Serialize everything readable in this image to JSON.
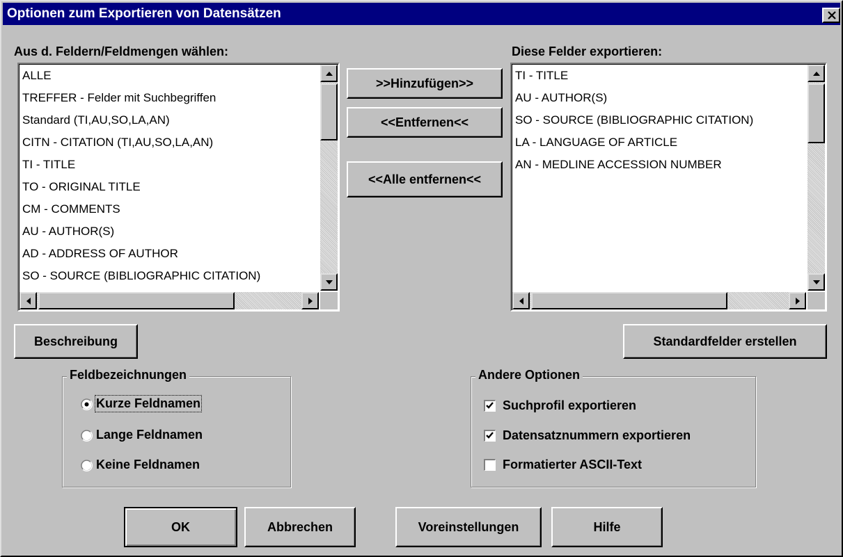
{
  "window": {
    "title": "Optionen zum Exportieren von Datensätzen"
  },
  "left_list": {
    "label": "Aus d. Feldern/Feldmengen wählen:",
    "items": [
      "ALLE",
      "TREFFER - Felder mit Suchbegriffen",
      "Standard (TI,AU,SO,LA,AN)",
      "CITN - CITATION (TI,AU,SO,LA,AN)",
      "TI - TITLE",
      "TO - ORIGINAL TITLE",
      "CM - COMMENTS",
      "AU - AUTHOR(S)",
      "AD - ADDRESS OF AUTHOR",
      "SO - SOURCE (BIBLIOGRAPHIC CITATION)"
    ]
  },
  "right_list": {
    "label": "Diese Felder exportieren:",
    "items": [
      "TI - TITLE",
      "AU - AUTHOR(S)",
      "SO - SOURCE (BIBLIOGRAPHIC CITATION)",
      "LA - LANGUAGE OF ARTICLE",
      "AN - MEDLINE ACCESSION NUMBER"
    ]
  },
  "buttons": {
    "add": ">>Hinzufügen>>",
    "remove": "<<Entfernen<<",
    "remove_all": "<<Alle entfernen<<",
    "description": "Beschreibung",
    "create_default": "Standardfelder erstellen",
    "ok": "OK",
    "cancel": "Abbrechen",
    "defaults": "Voreinstellungen",
    "help": "Hilfe"
  },
  "field_labels": {
    "title": "Feldbezeichnungen",
    "options": [
      {
        "label": "Kurze Feldnamen",
        "selected": true
      },
      {
        "label": "Lange Feldnamen",
        "selected": false
      },
      {
        "label": "Keine Feldnamen",
        "selected": false
      }
    ]
  },
  "other_options": {
    "title": "Andere Optionen",
    "options": [
      {
        "label": "Suchprofil exportieren",
        "checked": true
      },
      {
        "label": "Datensatznummern exportieren",
        "checked": true
      },
      {
        "label": "Formatierter ASCII-Text",
        "checked": false
      }
    ]
  }
}
